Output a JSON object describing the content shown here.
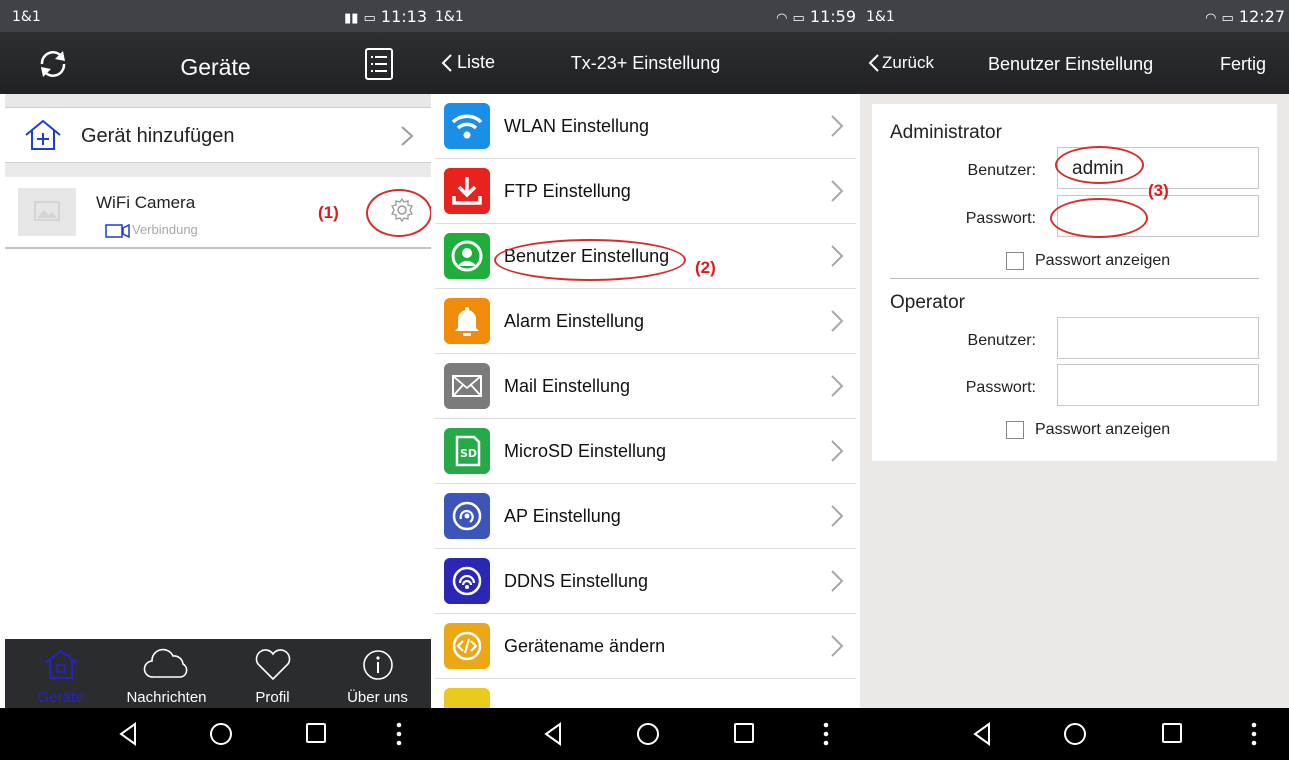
{
  "panel1": {
    "status": {
      "left": "1&1",
      "right": "11:13"
    },
    "title": "Geräte",
    "add_device_label": "Gerät hinzufügen",
    "camera": {
      "name": "WiFi Camera",
      "status": "Verbindung"
    },
    "annotation": "(1)",
    "tabs": [
      {
        "label": "Geräte",
        "icon": "home-icon",
        "active": true
      },
      {
        "label": "Nachrichten",
        "icon": "cloud-icon",
        "active": false
      },
      {
        "label": "Profil",
        "icon": "heart-icon",
        "active": false
      },
      {
        "label": "Über uns",
        "icon": "info-icon",
        "active": false
      }
    ]
  },
  "panel2": {
    "status": {
      "left": "1&1",
      "right": "11:59"
    },
    "back_label": "Liste",
    "title": "Tx-23+ Einstellung",
    "annotation": "(2)",
    "items": [
      {
        "label": "WLAN Einstellung",
        "icon": "wifi-icon",
        "color": "#1a8fe6"
      },
      {
        "label": "FTP Einstellung",
        "icon": "download-icon",
        "color": "#e8231f"
      },
      {
        "label": "Benutzer Einstellung",
        "icon": "user-icon",
        "color": "#1fae3c"
      },
      {
        "label": "Alarm Einstellung",
        "icon": "bell-icon",
        "color": "#f08b0c"
      },
      {
        "label": "Mail Einstellung",
        "icon": "mail-icon",
        "color": "#7b7b7b"
      },
      {
        "label": "MicroSD Einstellung",
        "icon": "sd-card-icon",
        "color": "#26a948"
      },
      {
        "label": "AP Einstellung",
        "icon": "ap-icon",
        "color": "#3d55b8"
      },
      {
        "label": "DDNS Einstellung",
        "icon": "ddns-icon",
        "color": "#2a27b5"
      },
      {
        "label": "Gerätename ändern",
        "icon": "code-icon",
        "color": "#eaa716"
      },
      {
        "label": "",
        "icon": "partial-icon",
        "color": "#eaca1c"
      }
    ]
  },
  "panel3": {
    "status": {
      "left": "1&1",
      "right": "12:27"
    },
    "back_label": "Zurück",
    "title": "Benutzer Einstellung",
    "done_label": "Fertig",
    "annotation": "(3)",
    "admin": {
      "section": "Administrator",
      "user_label": "Benutzer:",
      "user_value": "admin",
      "password_label": "Passwort:",
      "password_value": "",
      "show_password": "Passwort anzeigen"
    },
    "operator": {
      "section": "Operator",
      "user_label": "Benutzer:",
      "user_value": "",
      "password_label": "Passwort:",
      "password_value": "",
      "show_password": "Passwort anzeigen"
    }
  }
}
